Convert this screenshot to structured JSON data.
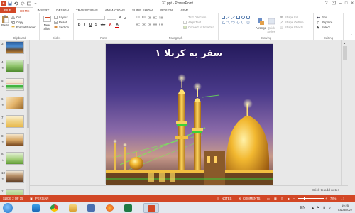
{
  "titlebar": {
    "title": "37.ppt - PowerPoint",
    "app_icon_text": "P",
    "minimize": "–",
    "maximize": "□",
    "close": "×",
    "help": "?"
  },
  "tabs": [
    {
      "label": "FILE"
    },
    {
      "label": "HOME"
    },
    {
      "label": "INSERT"
    },
    {
      "label": "DESIGN"
    },
    {
      "label": "TRANSITIONS"
    },
    {
      "label": "ANIMATIONS"
    },
    {
      "label": "SLIDE SHOW"
    },
    {
      "label": "REVIEW"
    },
    {
      "label": "VIEW"
    }
  ],
  "ribbon": {
    "clipboard": {
      "paste": "Paste",
      "cut": "Cut",
      "copy": "Copy",
      "format_painter": "Format Painter",
      "label": "Clipboard"
    },
    "slides": {
      "new_slide": "New Slide",
      "layout": "Layout",
      "reset": "Reset",
      "section": "Section",
      "label": "Slides"
    },
    "font": {
      "label": "Font",
      "bold": "B",
      "italic": "I",
      "underline": "U",
      "shadow": "S",
      "strike": "abc",
      "grow": "A",
      "shrink": "A",
      "clear": "A"
    },
    "paragraph": {
      "text_direction": "Text Direction",
      "align_text": "Align Text",
      "convert_smartart": "Convert to SmartArt",
      "label": "Paragraph"
    },
    "drawing": {
      "arrange": "Arrange",
      "quick_styles": "Quick Styles",
      "shape_fill": "Shape Fill",
      "shape_outline": "Shape Outline",
      "shape_effects": "Shape Effects",
      "label": "Drawing"
    },
    "editing": {
      "find": "Find",
      "replace": "Replace",
      "select": "Select",
      "label": "Editing"
    }
  },
  "thumbnails": [
    {
      "num": "3"
    },
    {
      "num": "4"
    },
    {
      "num": "5"
    },
    {
      "num": "6"
    },
    {
      "num": "7"
    },
    {
      "num": "8"
    },
    {
      "num": "9"
    },
    {
      "num": "10"
    },
    {
      "num": "11"
    }
  ],
  "slide": {
    "title": "سفر به کربلا ۱"
  },
  "notes": {
    "placeholder": "Click to add notes"
  },
  "statusbar": {
    "slide_info": "SLIDE 2 OF 15",
    "language": "PERSIAN",
    "notes": "NOTES",
    "comments": "COMMENTS",
    "zoom": "78%",
    "zoom_fraction": 0.78
  },
  "taskbar": {
    "time": "19:25",
    "date": "03/03/2022",
    "lang": "EN"
  },
  "colors": {
    "accent": "#d24726"
  }
}
